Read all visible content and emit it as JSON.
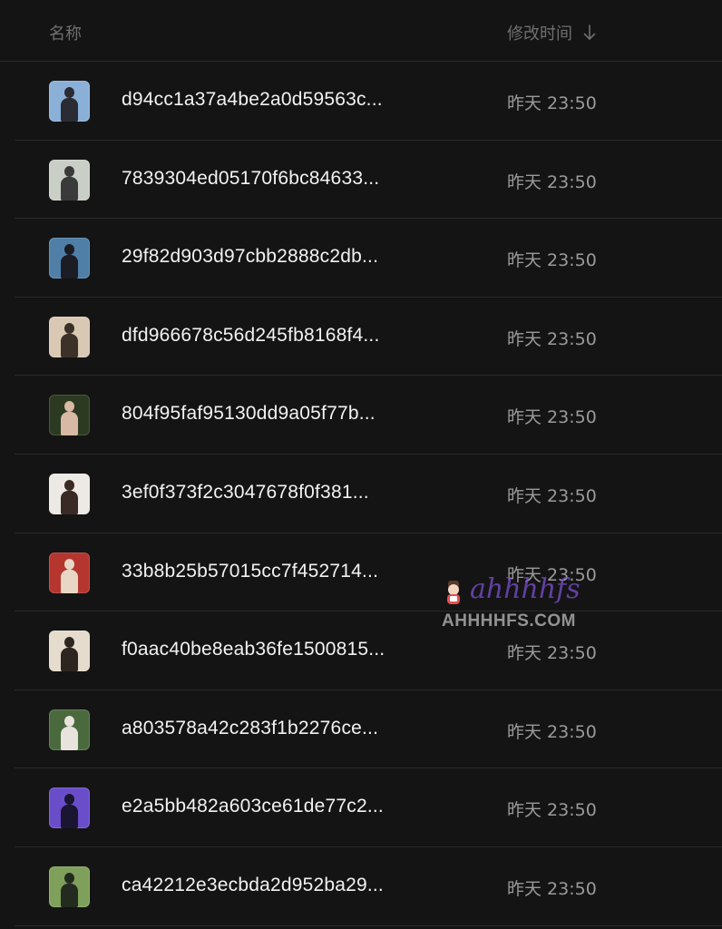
{
  "header": {
    "name_label": "名称",
    "time_label": "修改时间",
    "sort_icon": "arrow-down-icon"
  },
  "files": [
    {
      "name": "d94cc1a37a4be2a0d59563c...",
      "modified": "昨天 23:50",
      "thumb_bg": "#8ab0d8",
      "thumb_fg": "#2b2b33"
    },
    {
      "name": "7839304ed05170f6bc84633...",
      "modified": "昨天 23:50",
      "thumb_bg": "#c9cfc6",
      "thumb_fg": "#3a3a3a"
    },
    {
      "name": "29f82d903d97cbb2888c2db...",
      "modified": "昨天 23:50",
      "thumb_bg": "#4f7fa6",
      "thumb_fg": "#1c1c24"
    },
    {
      "name": "dfd966678c56d245fb8168f4...",
      "modified": "昨天 23:50",
      "thumb_bg": "#d9c8b4",
      "thumb_fg": "#3b3128"
    },
    {
      "name": "804f95faf95130dd9a05f77b...",
      "modified": "昨天 23:50",
      "thumb_bg": "#2c3a22",
      "thumb_fg": "#d8b9a3"
    },
    {
      "name": "3ef0f373f2c3047678f0f381...",
      "modified": "昨天 23:50",
      "thumb_bg": "#ede9e4",
      "thumb_fg": "#3a2a25"
    },
    {
      "name": "33b8b25b57015cc7f452714...",
      "modified": "昨天 23:50",
      "thumb_bg": "#b5362f",
      "thumb_fg": "#e9d7c6"
    },
    {
      "name": "f0aac40be8eab36fe1500815...",
      "modified": "昨天 23:50",
      "thumb_bg": "#e6dccd",
      "thumb_fg": "#2d2620"
    },
    {
      "name": "a803578a42c283f1b2276ce...",
      "modified": "昨天 23:50",
      "thumb_bg": "#4a6a3e",
      "thumb_fg": "#e8e3dc"
    },
    {
      "name": "e2a5bb482a603ce61de77c2...",
      "modified": "昨天 23:50",
      "thumb_bg": "#6a4dc9",
      "thumb_fg": "#1a1530"
    },
    {
      "name": "ca42212e3ecbda2d952ba29...",
      "modified": "昨天 23:50",
      "thumb_bg": "#7fa05a",
      "thumb_fg": "#232a20"
    }
  ],
  "watermark": {
    "script_text": "ahhhhfs",
    "text": "AHHHHFS.COM"
  }
}
